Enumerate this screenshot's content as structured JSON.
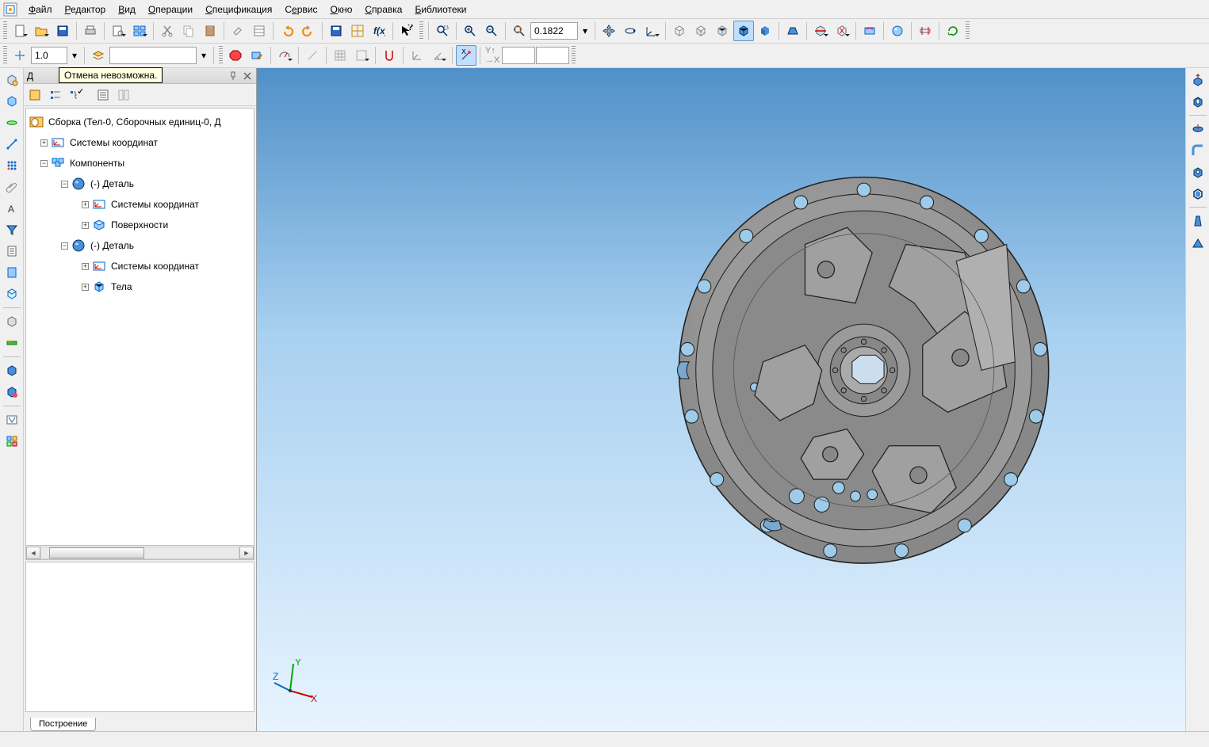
{
  "menu": {
    "items": [
      "Файл",
      "Редактор",
      "Вид",
      "Операции",
      "Спецификация",
      "Сервис",
      "Окно",
      "Справка",
      "Библиотеки"
    ]
  },
  "toolbar1": {
    "zoom_value": "0.1822"
  },
  "toolbar2": {
    "line_weight": "1.0",
    "style_value": "",
    "coord_x": "",
    "coord_y": ""
  },
  "panel": {
    "title_letter": "Д",
    "tooltip": "Отмена невозможна.",
    "tab": "Построение"
  },
  "tree": {
    "root": "Сборка (Тел-0, Сборочных единиц-0, Д",
    "n1": "Системы координат",
    "n2": "Компоненты",
    "n2a": "(-) Деталь",
    "n2a1": "Системы координат",
    "n2a2": "Поверхности",
    "n2b": "(-) Деталь",
    "n2b1": "Системы координат",
    "n2b2": "Тела"
  }
}
